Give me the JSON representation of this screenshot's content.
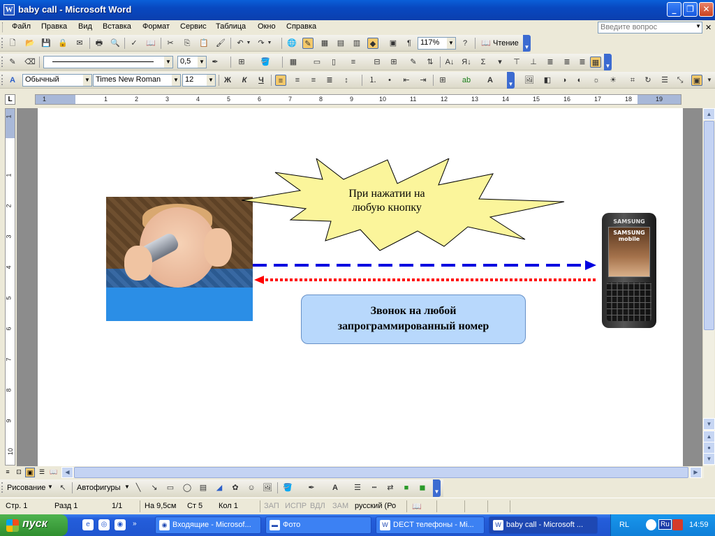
{
  "window": {
    "title": "baby call - Microsoft Word"
  },
  "menu": {
    "items": [
      "Файл",
      "Правка",
      "Вид",
      "Вставка",
      "Формат",
      "Сервис",
      "Таблица",
      "Окно",
      "Справка"
    ],
    "help_placeholder": "Введите вопрос"
  },
  "standard_toolbar": {
    "zoom": "117%",
    "reading_label": "Чтение"
  },
  "line_toolbar": {
    "line_width": "0,5"
  },
  "format_toolbar": {
    "style": "Обычный",
    "font": "Times New Roman",
    "size": "12",
    "bold": "Ж",
    "italic": "К",
    "underline": "Ч"
  },
  "ruler": {
    "h_numbers": [
      "1",
      "1",
      "2",
      "3",
      "4",
      "5",
      "6",
      "7",
      "8",
      "9",
      "10",
      "11",
      "12",
      "13",
      "14",
      "15",
      "16",
      "17",
      "18",
      "19"
    ],
    "v_numbers": [
      "1",
      "1",
      "2",
      "3",
      "4",
      "5",
      "6",
      "7",
      "8",
      "9",
      "10"
    ]
  },
  "document": {
    "burst_text_1": "При нажатии на",
    "burst_text_2": "любую кнопку",
    "call_text_1": "Звонок на любой",
    "call_text_2": "запрограммированный номер",
    "phone_brand": "SAMSUNG",
    "phone_screen_1": "SAMSUNG",
    "phone_screen_2": "mobile",
    "colors": {
      "burst_fill": "#fbf59b",
      "callbox_fill": "#b8d8fc",
      "arrow_blue": "#0000e0",
      "arrow_red": "#ff0000"
    }
  },
  "draw_toolbar": {
    "draw_label": "Рисование",
    "autoshapes_label": "Автофигуры"
  },
  "status": {
    "page": "Стр. 1",
    "section": "Разд 1",
    "pages": "1/1",
    "at": "На 9,5см",
    "line": "Ст 5",
    "col": "Кол 1",
    "rec": "ЗАП",
    "trk": "ИСПР",
    "ext": "ВДЛ",
    "ovr": "ЗАМ",
    "lang": "русский (Ро"
  },
  "taskbar": {
    "start_label": "пуск",
    "tasks": [
      "Входящие - Microsof...",
      "Фото",
      "DECT телефоны - Mi...",
      "baby call - Microsoft ..."
    ],
    "lang": "RL",
    "kbd": "Ru",
    "time": "14:59"
  }
}
